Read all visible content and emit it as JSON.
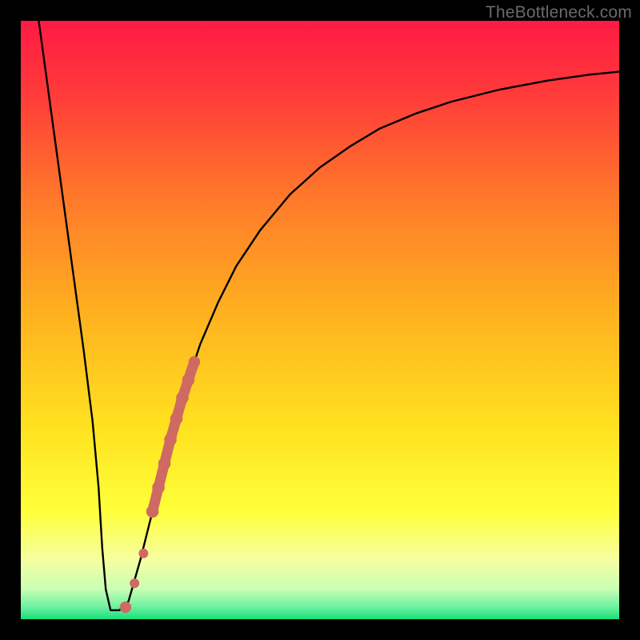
{
  "watermark": "TheBottleneck.com",
  "chart_data": {
    "type": "line",
    "title": "",
    "xlabel": "",
    "ylabel": "",
    "xlim": [
      0,
      100
    ],
    "ylim": [
      0,
      100
    ],
    "grid": false,
    "legend": false,
    "background_gradient_top": "#ff1a3f",
    "background_gradient_mid_upper": "#ff9e1f",
    "background_gradient_mid": "#ffe61f",
    "background_gradient_lower": "#f7ff8c",
    "background_gradient_bottom": "#18e07a",
    "series": [
      {
        "name": "bottleneck_curve",
        "color": "#000000",
        "x": [
          3.0,
          4.5,
          6.0,
          7.5,
          9.0,
          10.5,
          12.0,
          13.0,
          13.6,
          14.2,
          15.0,
          16.5,
          18.0,
          20.0,
          22.0,
          24.0,
          26.0,
          28.0,
          30.0,
          33.0,
          36.0,
          40.0,
          45.0,
          50.0,
          55.0,
          60.0,
          66.0,
          72.0,
          80.0,
          88.0,
          95.0,
          100.0
        ],
        "y": [
          100.0,
          89.0,
          78.0,
          67.0,
          56.0,
          45.0,
          33.0,
          22.0,
          12.0,
          5.0,
          1.5,
          1.5,
          3.0,
          10.0,
          18.0,
          26.0,
          33.0,
          40.0,
          46.0,
          53.0,
          59.0,
          65.0,
          71.0,
          75.5,
          79.0,
          82.0,
          84.5,
          86.5,
          88.5,
          90.0,
          91.0,
          91.5
        ]
      }
    ],
    "markers": [
      {
        "name": "highlight_points",
        "color": "#cf6a63",
        "shape": "circle",
        "points": [
          {
            "x": 17.5,
            "y": 2.0,
            "r": 1.2
          },
          {
            "x": 19.0,
            "y": 6.0,
            "r": 1.0
          },
          {
            "x": 20.5,
            "y": 11.0,
            "r": 1.0
          },
          {
            "x": 22.0,
            "y": 18.0,
            "r": 1.3
          },
          {
            "x": 23.0,
            "y": 22.0,
            "r": 1.3
          },
          {
            "x": 24.0,
            "y": 26.0,
            "r": 1.3
          },
          {
            "x": 25.0,
            "y": 30.0,
            "r": 1.3
          },
          {
            "x": 26.0,
            "y": 33.5,
            "r": 1.3
          },
          {
            "x": 27.0,
            "y": 37.0,
            "r": 1.3
          },
          {
            "x": 28.0,
            "y": 40.0,
            "r": 1.3
          },
          {
            "x": 29.0,
            "y": 43.0,
            "r": 1.2
          }
        ]
      }
    ]
  }
}
